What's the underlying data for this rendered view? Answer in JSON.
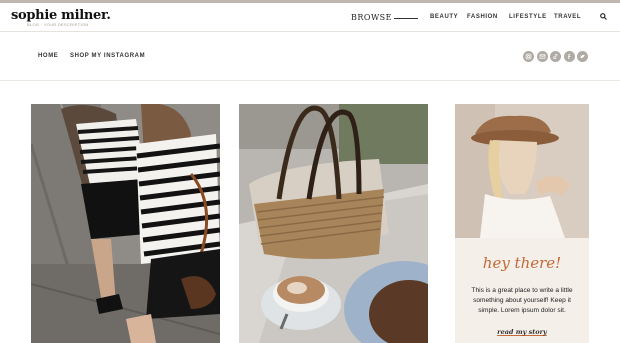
{
  "site": {
    "logo": "sophie milner.",
    "tagline": "BLOG · YOUR DESCRIPTION"
  },
  "header": {
    "browse_label": "BROWSE",
    "nav": [
      "BEAUTY",
      "FASHION",
      "LIFESTYLE",
      "TRAVEL"
    ]
  },
  "subnav": {
    "links": [
      "HOME",
      "SHOP MY INSTAGRAM"
    ]
  },
  "social_icons": [
    "instagram-icon",
    "email-icon",
    "tiktok-icon",
    "facebook-icon",
    "twitter-icon"
  ],
  "posts": [
    {
      "image": "two-women-striped-sweaters-photo"
    },
    {
      "image": "straw-basket-and-cappuccino-photo"
    }
  ],
  "sidebar": {
    "heading": "hey there!",
    "about_text": "This is a great place to write a little something about yourself! Keep it simple. Lorem ipsum dolor sit.",
    "read_more": "read my story"
  },
  "colors": {
    "accent": "#c46a3a",
    "social": "#b0aaa4",
    "sidebar_bg": "#f4efe9"
  }
}
